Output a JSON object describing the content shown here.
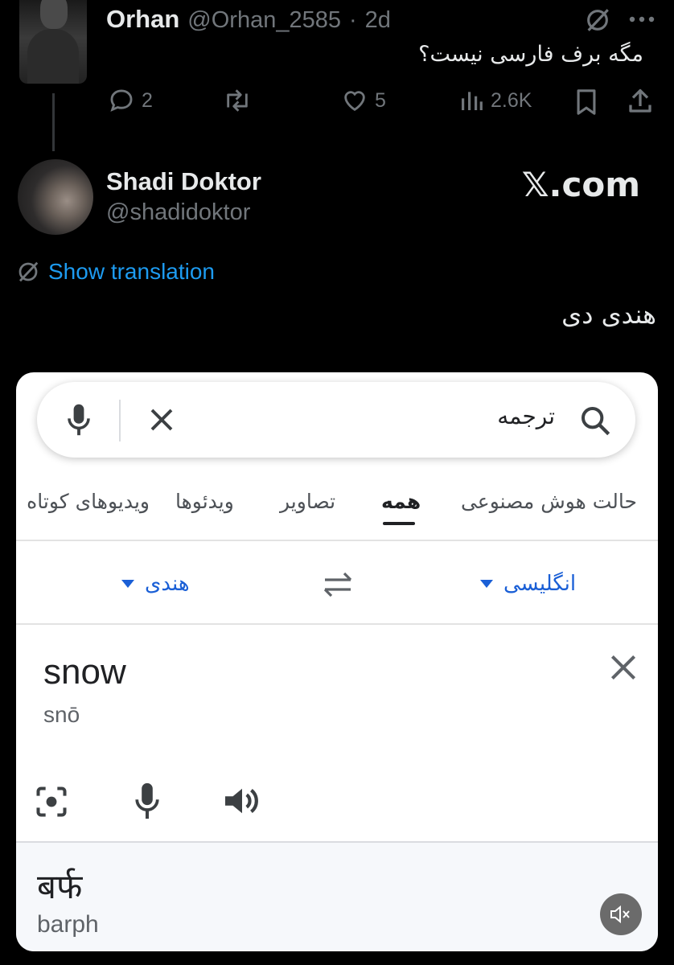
{
  "reply_to": {
    "name": "Orhan",
    "handle": "@Orhan_2585",
    "dot": "·",
    "time": "2d",
    "text": "مگه برف فارسی نیست؟",
    "actions": {
      "replies": "2",
      "likes": "5",
      "views": "2.6K"
    }
  },
  "post": {
    "name": "Shadi Doktor",
    "handle": "@shadidoktor",
    "watermark": "𝕏.com",
    "show_translation": "Show translation",
    "text": "هندی دی"
  },
  "screenshot": {
    "search_text": "ترجمه",
    "tabs": [
      "حالت هوش مصنوعی",
      "همه",
      "تصاویر",
      "ویدئوها",
      "ویدیوهای کوتاه"
    ],
    "active_tab": "همه",
    "source_lang": "انگلیسی",
    "target_lang": "هندی",
    "input_word": "snow",
    "input_phonetic": "snō",
    "output_word": "बर्फ",
    "output_phonetic": "barph"
  },
  "colors": {
    "bg": "#000000",
    "x_blue": "#1d9bf0",
    "google_blue": "#1a5fd6",
    "grey": "#71767b"
  }
}
